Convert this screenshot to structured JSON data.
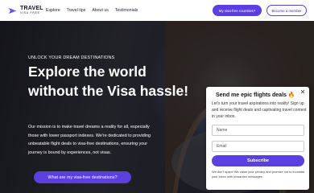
{
  "header": {
    "logo": {
      "word": "TRAVEL",
      "sub": "VISA FREE"
    },
    "nav": [
      "Explore",
      "Travel tips",
      "About us",
      "Testimonials"
    ],
    "primary_button": "My visa-free countries?",
    "secondary_button": "Become a member"
  },
  "hero": {
    "eyebrow": "UNLOCK YOUR DREAM DESTINATIONS",
    "headline": "Explore the world without the Visa hassle!",
    "intro": "Our mission is to make travel dreams a reality for all, especially those with lower passport indexes. We're dedicated to providing unbeatable flight deals to visa-free destinations, ensuring your journey is bound by experiences, not visas.",
    "cta": "What are my visa-free destinations?"
  },
  "popup": {
    "title": "Send me epic flights deals 🔥",
    "close_icon": "close-icon",
    "description": "Let's turn your travel aspirations into reality! Sign up and receive flight deals and captivating travel content in your inbox.",
    "name_placeholder": "Name",
    "email_placeholder": "Email",
    "submit": "Subscribe",
    "privacy": "We don't spam! We value your privacy and promise not to inundate your inbox with unwanted messages."
  },
  "colors": {
    "accent": "#5b3fe0"
  }
}
